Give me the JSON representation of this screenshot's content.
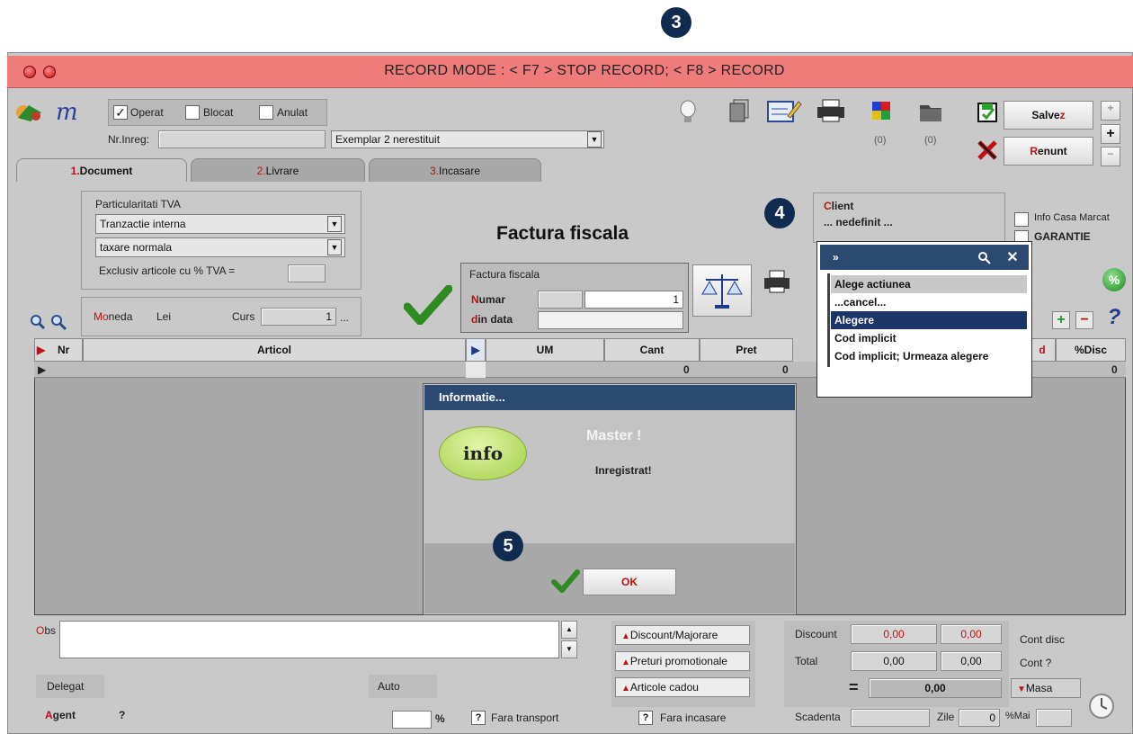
{
  "badges": {
    "b3": "3",
    "b4": "4",
    "b5": "5"
  },
  "titlebar": {
    "text": "RECORD MODE : < F7 > STOP RECORD; < F8 > RECORD"
  },
  "toolbar": {
    "operat": "Operat",
    "blocat": "Blocat",
    "anulat": "Anulat",
    "nr_inreg_label": "Nr.Inreg:",
    "exemplar_value": "Exemplar 2 nerestituit",
    "count1": "(0)",
    "count2": "(0)",
    "save_hot": "z",
    "save_rest": "Salve",
    "cancel_hot": "R",
    "cancel_rest": "enunt"
  },
  "tabs": [
    {
      "num": "1.",
      "label": "Document"
    },
    {
      "num": "2.",
      "label": "Livrare"
    },
    {
      "num": "3.",
      "label": "Incasare"
    }
  ],
  "tva": {
    "title": "Particularitati TVA",
    "option1": "Tranzactie interna",
    "option2": "taxare normala",
    "exclusive": "Exclusiv articole cu % TVA ="
  },
  "doc": {
    "heading": "Factura fiscala",
    "box_title": "Factura fiscala",
    "numar_hot": "N",
    "numar_rest": "umar",
    "numar_value": "1",
    "data_hot": "d",
    "data_rest": "in data"
  },
  "currency": {
    "moneda_hot": "Mo",
    "moneda_rest": "neda",
    "moneda_value": "Lei",
    "curs_label": "Curs",
    "curs_value": "1",
    "ellipsis": "..."
  },
  "client": {
    "hot": "C",
    "rest": "lient",
    "value": "... nedefinit ...",
    "info_casa": "Info Casa Marcat",
    "garantie": "GARANTIE"
  },
  "grid": {
    "columns": [
      "Nr",
      "Articol",
      "UM",
      "Cant",
      "Pret",
      "d",
      "%Disc"
    ],
    "row_values": [
      "0",
      "0",
      "0"
    ]
  },
  "dialog": {
    "title": "Informatie...",
    "info_badge": "info",
    "heading": "Master !",
    "message": "Inregistrat!",
    "ok": "OK"
  },
  "menu": {
    "header": "»",
    "title": "Alege actiunea",
    "items": [
      "...cancel...",
      "Alegere",
      "Cod implicit",
      "Cod implicit; Urmeaza alegere"
    ]
  },
  "bottom": {
    "obs_hot": "O",
    "obs_rest": "bs",
    "delegat": "Delegat",
    "auto": "Auto",
    "agent_hot": "A",
    "agent_rest": "gent",
    "agent_q": "?",
    "percent": "%",
    "q": "?",
    "fara_transport": "Fara transport",
    "discount_majorare": "Discount/Majorare",
    "preturi": "Preturi promotionale",
    "cadou": "Articole cadou",
    "fara_incasare": "Fara incasare",
    "discount": "Discount",
    "total": "Total",
    "disc_v1": "0,00",
    "disc_v2": "0,00",
    "total_v1": "0,00",
    "total_v2": "0,00",
    "eq": "=",
    "grand": "0,00",
    "cont_disc": "Cont disc",
    "cont_q": "Cont ?",
    "masa": "Masa",
    "scadenta": "Scadenta",
    "zile": "Zile",
    "zile_v": "0",
    "mai": "%Mai"
  },
  "colors": {
    "titlebar": "#f07b7b",
    "dialog_title": "#2b4a72",
    "accent_red": "#c01010",
    "badge": "#0f2b4f"
  }
}
